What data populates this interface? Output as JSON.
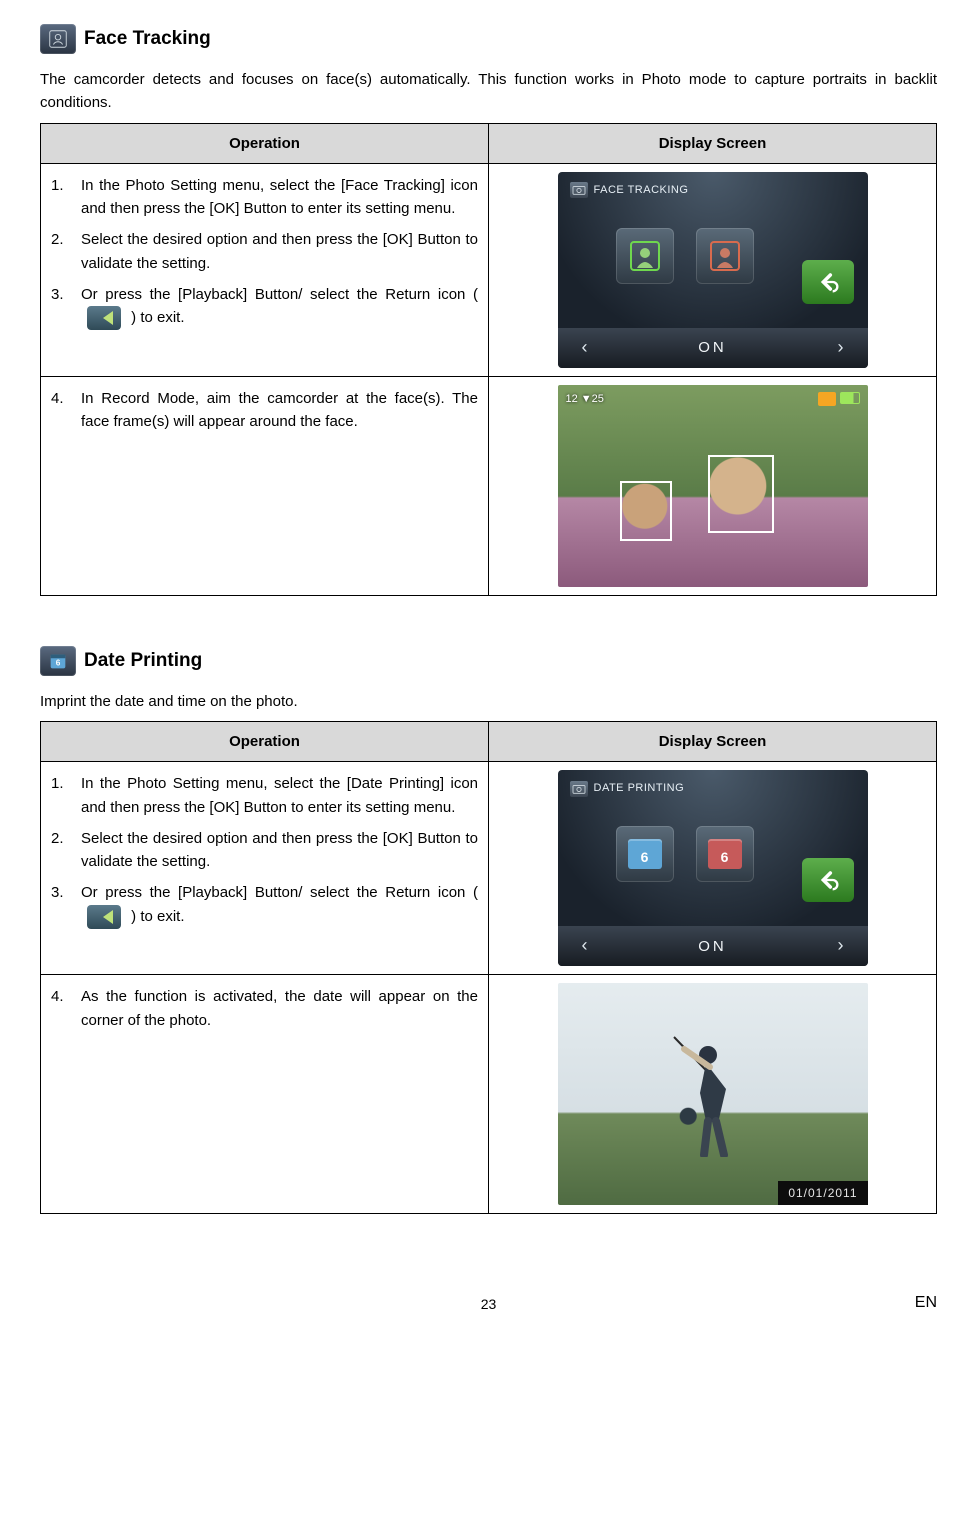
{
  "sections": [
    {
      "title": "Face Tracking",
      "intro": "The camcorder detects and focuses on face(s) automatically. This function works in Photo mode to capture portraits in backlit conditions.",
      "header_op": "Operation",
      "header_ds": "Display Screen",
      "steps": [
        "In the Photo Setting menu, select the [Face Tracking] icon and then press the [OK] Button to enter its setting menu.",
        "Select the desired option and then press the [OK] Button to validate the setting.",
        "Or press the [Playback] Button/ select the Return icon ( {return} ) to exit."
      ],
      "screen_title": "FACE TRACKING",
      "screen_state": "ON",
      "record_step_num": "4.",
      "record_step": "In Record Mode, aim the camcorder at the face(s). The face frame(s) will appear around the face.",
      "hud_left": "12    ▼25"
    },
    {
      "title": "Date Printing",
      "intro": "Imprint the date and time on the photo.",
      "header_op": "Operation",
      "header_ds": "Display Screen",
      "steps": [
        "In the Photo Setting menu, select the [Date Printing] icon and then press the [OK] Button to enter its setting menu.",
        "Select the desired option and then press the [OK] Button to validate the setting.",
        "Or press the [Playback] Button/ select the Return icon ( {return} ) to exit."
      ],
      "screen_title": "DATE PRINTING",
      "screen_state": "ON",
      "record_step_num": "4.",
      "record_step": "As the function is activated, the date will appear on the corner of the photo.",
      "photo_date": "01/01/2011"
    }
  ],
  "page_number": "23",
  "language": "EN"
}
